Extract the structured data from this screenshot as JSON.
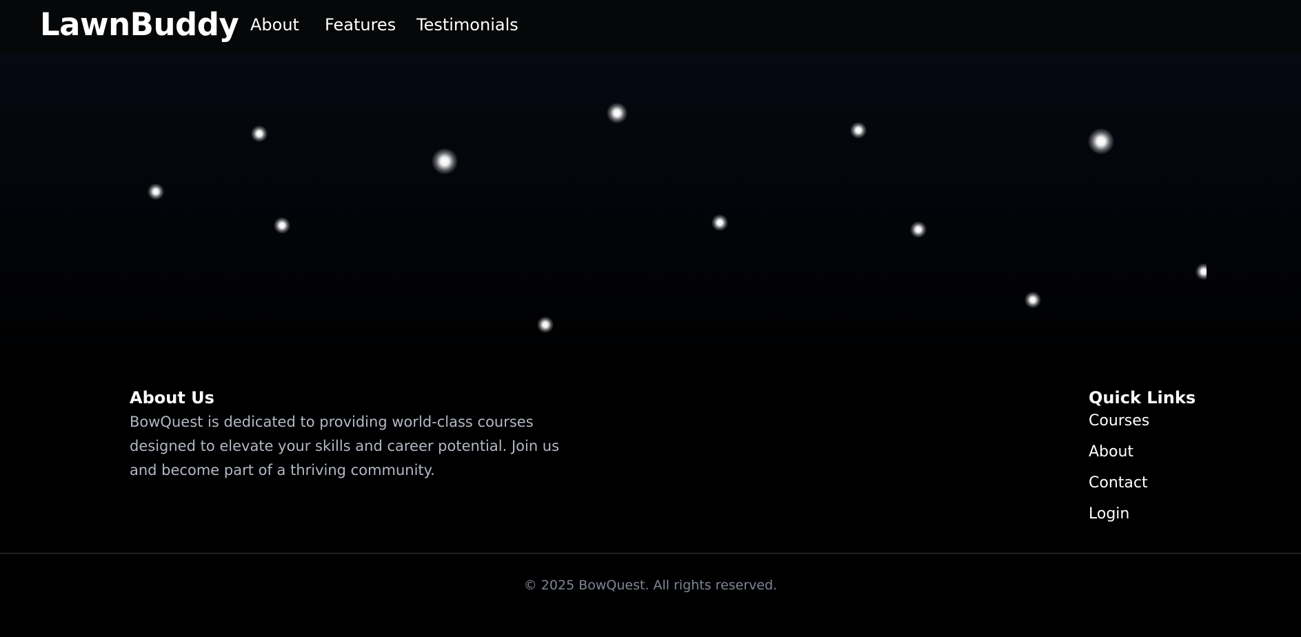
{
  "header": {
    "brand": "LawnBuddy",
    "nav": {
      "about": "About",
      "features": "Features",
      "testimonials": "Testimonials"
    }
  },
  "footer": {
    "about": {
      "title": "About Us",
      "text": "BowQuest is dedicated to providing world-class courses designed to elevate your skills and career potential. Join us and become part of a thriving community."
    },
    "quick_links": {
      "title": "Quick Links",
      "items": [
        "Courses",
        "About",
        "Contact",
        "Login"
      ]
    },
    "copyright": "© 2025 BowQuest. All rights reserved."
  },
  "colors": {
    "background": "#000000",
    "header_background": "#060708",
    "text_primary": "#ffffff",
    "text_secondary": "#b3b8c4",
    "text_muted": "#7f8696",
    "divider": "#3a3f4a"
  }
}
